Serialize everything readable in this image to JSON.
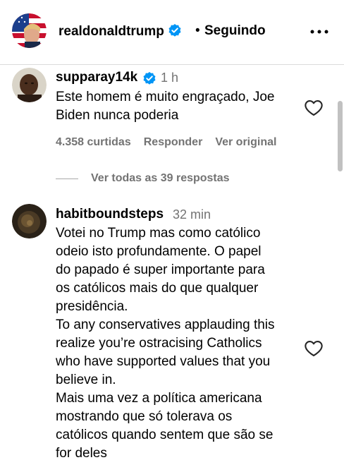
{
  "header": {
    "username": "realdonaldtrump",
    "separator": "•",
    "follow_status": "Seguindo"
  },
  "comments": [
    {
      "username": "supparay14k",
      "verified": true,
      "time": "1 h",
      "text": "Este homem é muito engraçado, Joe\nBiden nunca poderia",
      "likes": "4.358 curtidas",
      "reply_label": "Responder",
      "original_label": "Ver original",
      "view_replies": "Ver todas as 39 respostas"
    },
    {
      "username": "habitboundsteps",
      "verified": false,
      "time": "32 min",
      "text": "Votei no Trump mas como católico\nodeio isto profundamente. O papel\ndo papado é super importante para\nos católicos mais do que qualquer\npresidência.\nTo any conservatives applauding this\nrealize you’re ostracising Catholics\nwho have supported values that you\nbelieve in.\nMais uma vez a política americana\nmostrando que só tolerava os\ncatólicos quando sentem que são se\nfor deles"
    }
  ],
  "colors": {
    "verified_blue": "#0095f6",
    "secondary_text": "#737373",
    "divider": "#dbdbdb"
  },
  "icons": {
    "more": "more-horizontal-icon",
    "like": "heart-outline-icon",
    "verified": "verified-badge-icon"
  }
}
